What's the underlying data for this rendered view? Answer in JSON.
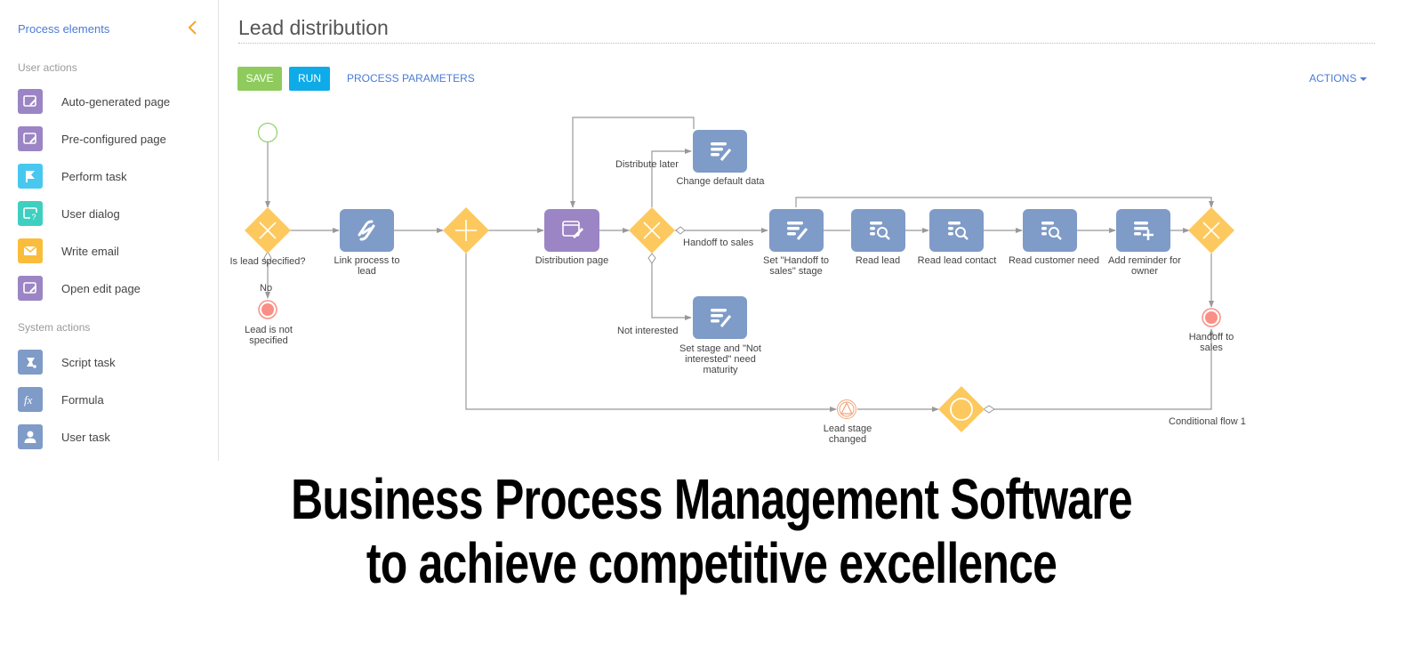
{
  "sidebar": {
    "title": "Process elements",
    "collapse_icon": "chevron-left-icon",
    "groups": [
      {
        "label": "User actions",
        "items": [
          {
            "label": "Auto-generated page",
            "icon": "page-edit-icon",
            "color": "#9b85c4"
          },
          {
            "label": "Pre-configured page",
            "icon": "page-edit-icon",
            "color": "#9b85c4"
          },
          {
            "label": "Perform task",
            "icon": "flag-icon",
            "color": "#48c8ef"
          },
          {
            "label": "User dialog",
            "icon": "dialog-question-icon",
            "color": "#3fcfc0"
          },
          {
            "label": "Write email",
            "icon": "envelope-icon",
            "color": "#f9bd3b"
          },
          {
            "label": "Open edit page",
            "icon": "page-edit-icon",
            "color": "#9b85c4"
          }
        ]
      },
      {
        "label": "System actions",
        "items": [
          {
            "label": "Script task",
            "icon": "script-icon",
            "color": "#7f9bc7"
          },
          {
            "label": "Formula",
            "icon": "formula-fx-icon",
            "color": "#7f9bc7"
          },
          {
            "label": "User task",
            "icon": "user-icon",
            "color": "#7f9bc7"
          }
        ]
      }
    ]
  },
  "header": {
    "title": "Lead distribution",
    "save_label": "SAVE",
    "run_label": "RUN",
    "params_label": "PROCESS PARAMETERS",
    "actions_label": "ACTIONS"
  },
  "colors": {
    "accent": "#4b7bd6",
    "save": "#8ecb5c",
    "run": "#0eabe8",
    "gateway": "#fdc95e",
    "task": "#7f9bc7",
    "page": "#9b85c4",
    "end_event": "#f98f86",
    "start_event": "#8fd16a"
  },
  "diagram": {
    "nodes": {
      "start": {
        "label": ""
      },
      "gw_lead_specified": {
        "label": "Is lead specified?",
        "type": "exclusive-gateway"
      },
      "lead_not_specified": {
        "label": "Lead is not specified",
        "type": "end-event"
      },
      "link_process": {
        "label": "Link process to lead",
        "type": "task",
        "icon": "link-icon"
      },
      "gw_parallel": {
        "label": "",
        "type": "parallel-gateway"
      },
      "distribution_page": {
        "label": "Distribution page",
        "type": "page",
        "icon": "page-edit-icon"
      },
      "gw_distribution": {
        "label": "",
        "type": "exclusive-gateway"
      },
      "change_default": {
        "label": "Change default data",
        "type": "task",
        "icon": "data-edit-icon"
      },
      "set_not_interested": {
        "label": "Set stage and \"Not interested\" need maturity",
        "type": "task",
        "icon": "data-edit-icon"
      },
      "set_handoff": {
        "label": "Set \"Handoff to sales\" stage",
        "type": "task",
        "icon": "data-edit-icon"
      },
      "read_lead": {
        "label": "Read lead",
        "type": "task",
        "icon": "data-search-icon"
      },
      "read_lead_contact": {
        "label": "Read lead contact",
        "type": "task",
        "icon": "data-search-icon"
      },
      "read_customer_need": {
        "label": "Read customer need",
        "type": "task",
        "icon": "data-search-icon"
      },
      "add_reminder": {
        "label": "Add reminder for owner",
        "type": "task",
        "icon": "data-add-icon"
      },
      "gw_merge": {
        "label": "",
        "type": "exclusive-gateway"
      },
      "handoff_end": {
        "label": "Handoff to sales",
        "type": "end-event"
      },
      "lead_stage_changed": {
        "label": "Lead stage changed",
        "type": "intermediate-signal-event"
      },
      "gw_event": {
        "label": "",
        "type": "event-gateway"
      }
    },
    "flow_labels": {
      "no": "No",
      "distribute_later": "Distribute later",
      "handoff_to_sales": "Handoff to sales",
      "not_interested": "Not interested",
      "conditional_flow_1": "Conditional flow 1"
    }
  },
  "banner": {
    "line1": "Business Process Management Software",
    "line2": "to achieve competitive excellence"
  }
}
